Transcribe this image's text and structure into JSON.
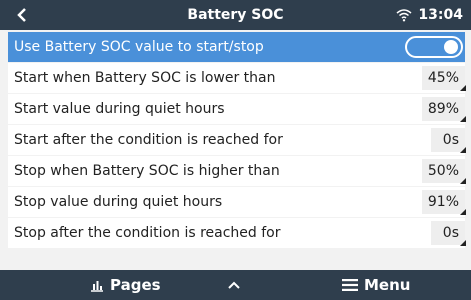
{
  "header": {
    "title": "Battery SOC",
    "time": "13:04"
  },
  "rows": [
    {
      "label": "Use Battery SOC value to start/stop",
      "type": "toggle",
      "state": "on"
    },
    {
      "label": "Start when Battery SOC is lower than",
      "value": "45%"
    },
    {
      "label": "Start value during quiet hours",
      "value": "89%"
    },
    {
      "label": "Start after the condition is reached for",
      "value": "0s"
    },
    {
      "label": "Stop when Battery SOC is higher than",
      "value": "50%"
    },
    {
      "label": "Stop value during quiet hours",
      "value": "91%"
    },
    {
      "label": "Stop after the condition is reached for",
      "value": "0s"
    }
  ],
  "footer": {
    "pages_label": "Pages",
    "menu_label": "Menu"
  },
  "colors": {
    "header_bg": "#2f3e4d",
    "selected_row": "#4a90d9",
    "background": "#f2f2f2"
  }
}
